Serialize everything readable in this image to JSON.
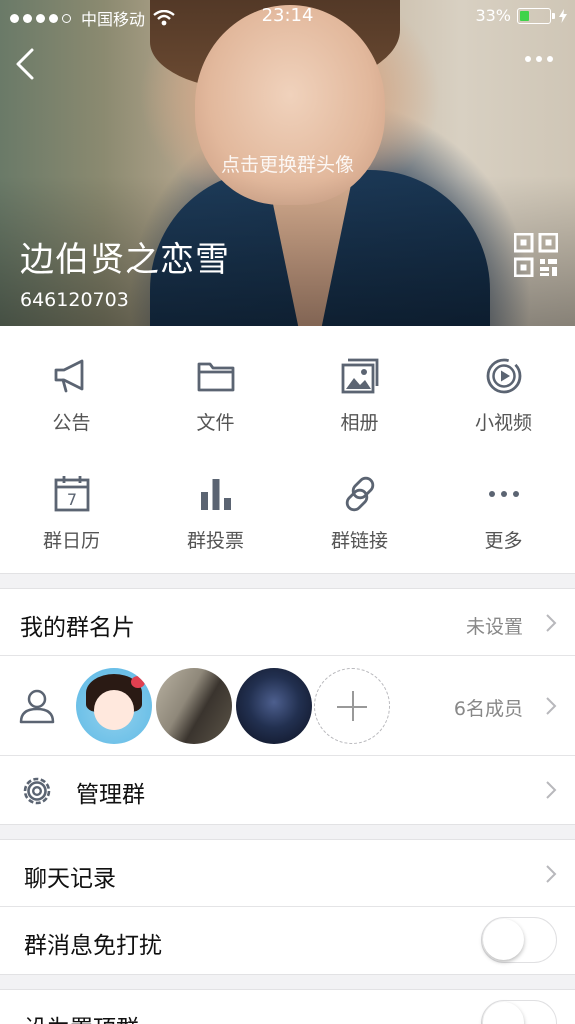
{
  "status_bar": {
    "carrier": "中国移动",
    "time": "23:14",
    "battery_percent": "33%",
    "battery_level": 0.33,
    "battery_color": "#3ed34a"
  },
  "header": {
    "back_icon": "chevron-left-icon",
    "more_icon": "more-dots-icon",
    "change_avatar_hint": "点击更换群头像",
    "group_name": "边伯贤之恋雪",
    "group_id": "646120703",
    "qr_icon": "qr-code-icon"
  },
  "functions": [
    {
      "label": "公告",
      "icon": "megaphone-icon"
    },
    {
      "label": "文件",
      "icon": "folder-icon"
    },
    {
      "label": "相册",
      "icon": "photo-album-icon"
    },
    {
      "label": "小视频",
      "icon": "video-play-icon"
    },
    {
      "label": "群日历",
      "icon": "calendar-icon"
    },
    {
      "label": "群投票",
      "icon": "bar-chart-icon"
    },
    {
      "label": "群链接",
      "icon": "link-icon"
    },
    {
      "label": "更多",
      "icon": "more-dots-icon"
    }
  ],
  "calendar_day": "7",
  "card": {
    "title": "我的群名片",
    "value": "未设置"
  },
  "members": {
    "count_label": "6名成员"
  },
  "manage": {
    "title": "管理群"
  },
  "chat_history": {
    "title": "聊天记录"
  },
  "mute": {
    "title": "群消息免打扰",
    "enabled": false
  },
  "pin": {
    "title": "设为置顶群",
    "enabled": false
  },
  "colors": {
    "icon": "#5b6472",
    "text_secondary": "#888888"
  }
}
